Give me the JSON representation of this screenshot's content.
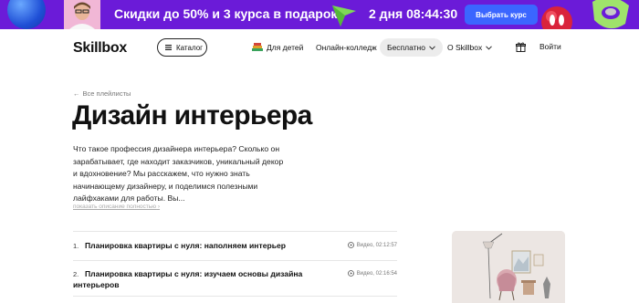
{
  "promo": {
    "text": "Скидки до 50% и 3 курса в подарок",
    "timer": "2 дня 08:44:30",
    "button_label": "Выбрать курс",
    "colors": {
      "background": "#6b1bd8",
      "button": "#3b66ff"
    }
  },
  "header": {
    "logo": "Skillbox",
    "catalog_label": "Каталог",
    "nav": {
      "kids": "Для детей",
      "college": "Онлайн-колледж",
      "free": "Бесплатно",
      "about": "О Skillbox"
    },
    "login_label": "Войти"
  },
  "main": {
    "back_link": "Все плейлисты",
    "title": "Дизайн интерьера",
    "description": "Что такое профессия дизайнера интерьера? Сколько он зарабатывает, где находит заказчиков, уникальный декор и вдохновение? Мы расскажем, что нужно знать начинающему дизайнеру, и поделимся полезными лайфхаками для работы. Вы...",
    "show_more": "показать описание полностью",
    "lessons": [
      {
        "number": "1.",
        "title": "Планировка квартиры с нуля: наполняем интерьер",
        "meta": "Видео, 02:12:57"
      },
      {
        "number": "2.",
        "title": "Планировка квартиры с нуля: изучаем основы дизайна интерьеров",
        "meta": "Видео, 02:16:54"
      }
    ]
  }
}
